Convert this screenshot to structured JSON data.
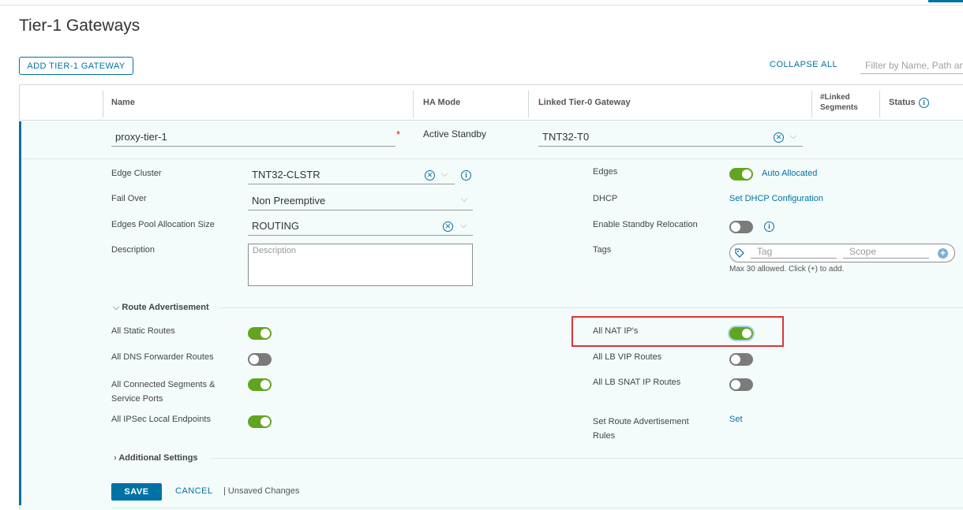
{
  "page": {
    "title": "Tier-1 Gateways",
    "add_button": "ADD TIER-1 GATEWAY",
    "collapse_all": "COLLAPSE ALL",
    "filter_placeholder": "Filter by Name, Path and more"
  },
  "grid": {
    "headers": {
      "name": "Name",
      "ha_mode": "HA Mode",
      "linked_t0": "Linked Tier-0 Gateway",
      "linked_segments_1": "#Linked",
      "linked_segments_2": "Segments",
      "status": "Status"
    },
    "row": {
      "name_value": "proxy-tier-1",
      "required_marker": "*",
      "ha_mode": "Active Standby",
      "linked_t0": "TNT32-T0"
    }
  },
  "details": {
    "left": {
      "edge_cluster_label": "Edge Cluster",
      "edge_cluster_value": "TNT32-CLSTR",
      "fail_over_label": "Fail Over",
      "fail_over_value": "Non Preemptive",
      "pool_size_label": "Edges Pool Allocation Size",
      "pool_size_value": "ROUTING",
      "description_label": "Description",
      "description_placeholder": "Description"
    },
    "right": {
      "edges_label": "Edges",
      "edges_toggle_on": true,
      "edges_value": "Auto Allocated",
      "dhcp_label": "DHCP",
      "dhcp_link": "Set DHCP Configuration",
      "standby_label": "Enable Standby Relocation",
      "standby_toggle_on": false,
      "tags_label": "Tags",
      "tag_placeholder": "Tag",
      "scope_placeholder": "Scope",
      "tags_hint": "Max 30 allowed. Click (+) to add."
    }
  },
  "route_advertisement": {
    "title": "Route Advertisement",
    "left": [
      {
        "label": "All Static Routes",
        "on": true
      },
      {
        "label": "All DNS Forwarder Routes",
        "on": false
      },
      {
        "label_line1": "All Connected Segments &",
        "label_line2": "Service Ports",
        "on": true
      },
      {
        "label": "All IPSec Local Endpoints",
        "on": true
      }
    ],
    "right": [
      {
        "label": "All NAT IP's",
        "on": true
      },
      {
        "label": "All LB VIP Routes",
        "on": false
      },
      {
        "label": "All LB SNAT IP Routes",
        "on": false
      },
      {
        "label_line1": "Set Route Advertisement",
        "label_line2": "Rules",
        "link": "Set"
      }
    ]
  },
  "additional_settings": {
    "title": "Additional Settings"
  },
  "footer": {
    "save": "SAVE",
    "cancel": "CANCEL",
    "unsaved": "| Unsaved Changes"
  },
  "colors": {
    "accent": "#0072a3",
    "toggle_on": "#62a420",
    "toggle_off": "#7b7b7b",
    "highlight": "#d9363a"
  },
  "icons": [
    "clear-icon",
    "chevron-down-icon",
    "info-icon",
    "tag-icon",
    "add-circle-icon",
    "chevron-right-icon"
  ]
}
